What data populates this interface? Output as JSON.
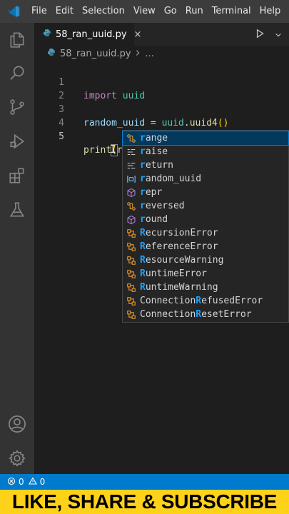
{
  "menubar": {
    "items": [
      "File",
      "Edit",
      "Selection",
      "View",
      "Go",
      "Run",
      "Terminal",
      "Help"
    ]
  },
  "activitybar": {
    "icons": [
      "explorer-icon",
      "search-icon",
      "source-control-icon",
      "run-debug-icon",
      "extensions-icon",
      "testing-icon",
      "accounts-icon",
      "manage-gear-icon"
    ]
  },
  "tab": {
    "filename": "58_ran_uuid.py",
    "close": "×"
  },
  "breadcrumb": {
    "file": "58_ran_uuid.py",
    "more": "..."
  },
  "editor": {
    "lines": [
      {
        "number": "1"
      },
      {
        "number": "2"
      },
      {
        "number": "3"
      },
      {
        "number": "4"
      },
      {
        "number": "5"
      }
    ],
    "line1": {
      "kw": "import",
      "mod": "uuid"
    },
    "line3": {
      "var": "random_uuid",
      "op": " = ",
      "mod": "uuid",
      "dot": ".",
      "fn": "uuid4",
      "parens": "()"
    },
    "line5": {
      "fn": "print",
      "open": "(",
      "typed": "r",
      "close": ")"
    }
  },
  "suggest": {
    "items": [
      {
        "kind": "function",
        "match": "r",
        "rest": "ange"
      },
      {
        "kind": "keyword",
        "match": "r",
        "rest": "aise"
      },
      {
        "kind": "keyword",
        "match": "r",
        "rest": "eturn"
      },
      {
        "kind": "variable",
        "match": "r",
        "rest": "andom_uuid"
      },
      {
        "kind": "method",
        "match": "r",
        "rest": "epr"
      },
      {
        "kind": "function",
        "match": "r",
        "rest": "eversed"
      },
      {
        "kind": "method",
        "match": "r",
        "rest": "ound"
      },
      {
        "kind": "class",
        "match": "R",
        "rest": "ecursionError"
      },
      {
        "kind": "class",
        "match": "R",
        "rest": "eferenceError"
      },
      {
        "kind": "class",
        "match": "R",
        "rest": "esourceWarning"
      },
      {
        "kind": "class",
        "match": "R",
        "rest": "untimeError"
      },
      {
        "kind": "class",
        "match": "R",
        "rest": "untimeWarning"
      },
      {
        "kind": "class",
        "pre": "Connection",
        "match": "R",
        "rest": "efusedError"
      },
      {
        "kind": "class",
        "pre": "Connection",
        "match": "R",
        "rest": "esetError"
      }
    ]
  },
  "statusbar": {
    "errors": "0",
    "warnings": "0"
  },
  "banner": {
    "text": "LIKE, SHARE & SUBSCRIBE"
  },
  "colors": {
    "accent": "#007acc",
    "banner": "#ffd21a",
    "match_highlight": "#18a3ff"
  }
}
